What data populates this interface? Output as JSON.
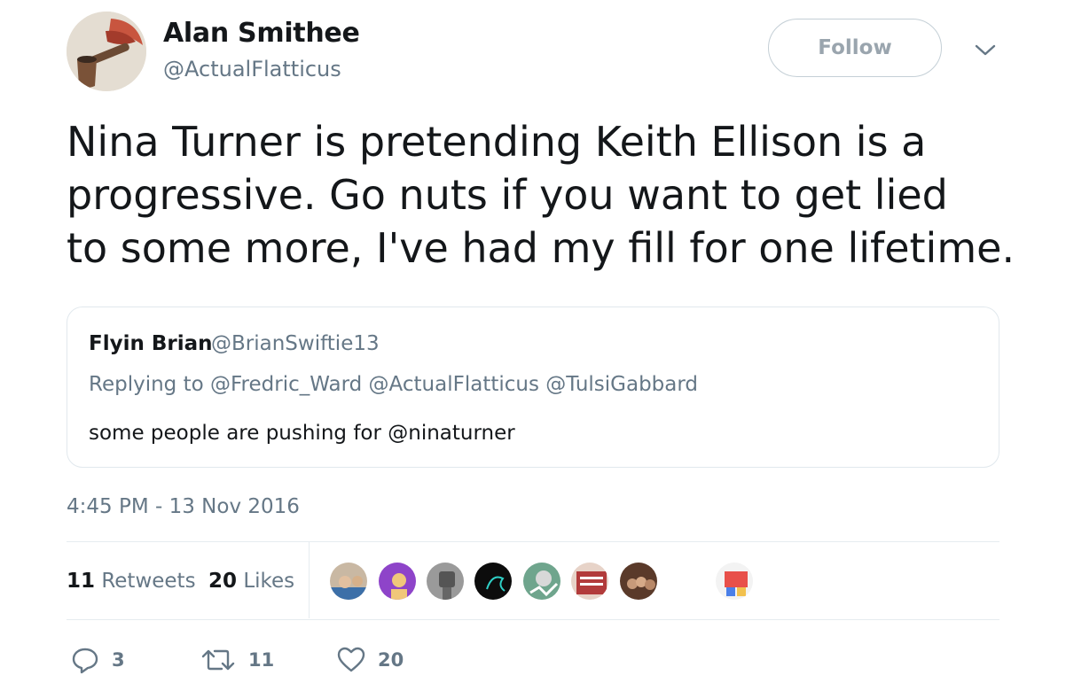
{
  "author": {
    "name": "Alan Smithee",
    "handle": "@ActualFlatticus"
  },
  "follow_label": "Follow",
  "tweet_text": "Nina Turner is pretending Keith Ellison is a\nprogressive.  Go nuts if you want to get lied\nto some more, I've had my fill for one lifetime.",
  "quoted_tweet": {
    "name": "Flyin Brian",
    "handle": "@BrianSwiftie13",
    "replying_to": "Replying to @Fredric_Ward @ActualFlatticus @TulsiGabbard",
    "text": "some people are pushing for @ninaturner"
  },
  "timestamp": "4:45 PM - 13 Nov 2016",
  "stats": {
    "retweets_count": "11",
    "retweets_label": "Retweets",
    "likes_count": "20",
    "likes_label": "Likes"
  },
  "actions": {
    "reply_count": "3",
    "retweet_count": "11",
    "like_count": "20"
  },
  "colors": {
    "text_primary": "#14171a",
    "text_secondary": "#657786",
    "border": "#e1e8ed"
  },
  "icons": [
    "caret-down-icon",
    "reply-icon",
    "retweet-icon",
    "heart-icon"
  ]
}
